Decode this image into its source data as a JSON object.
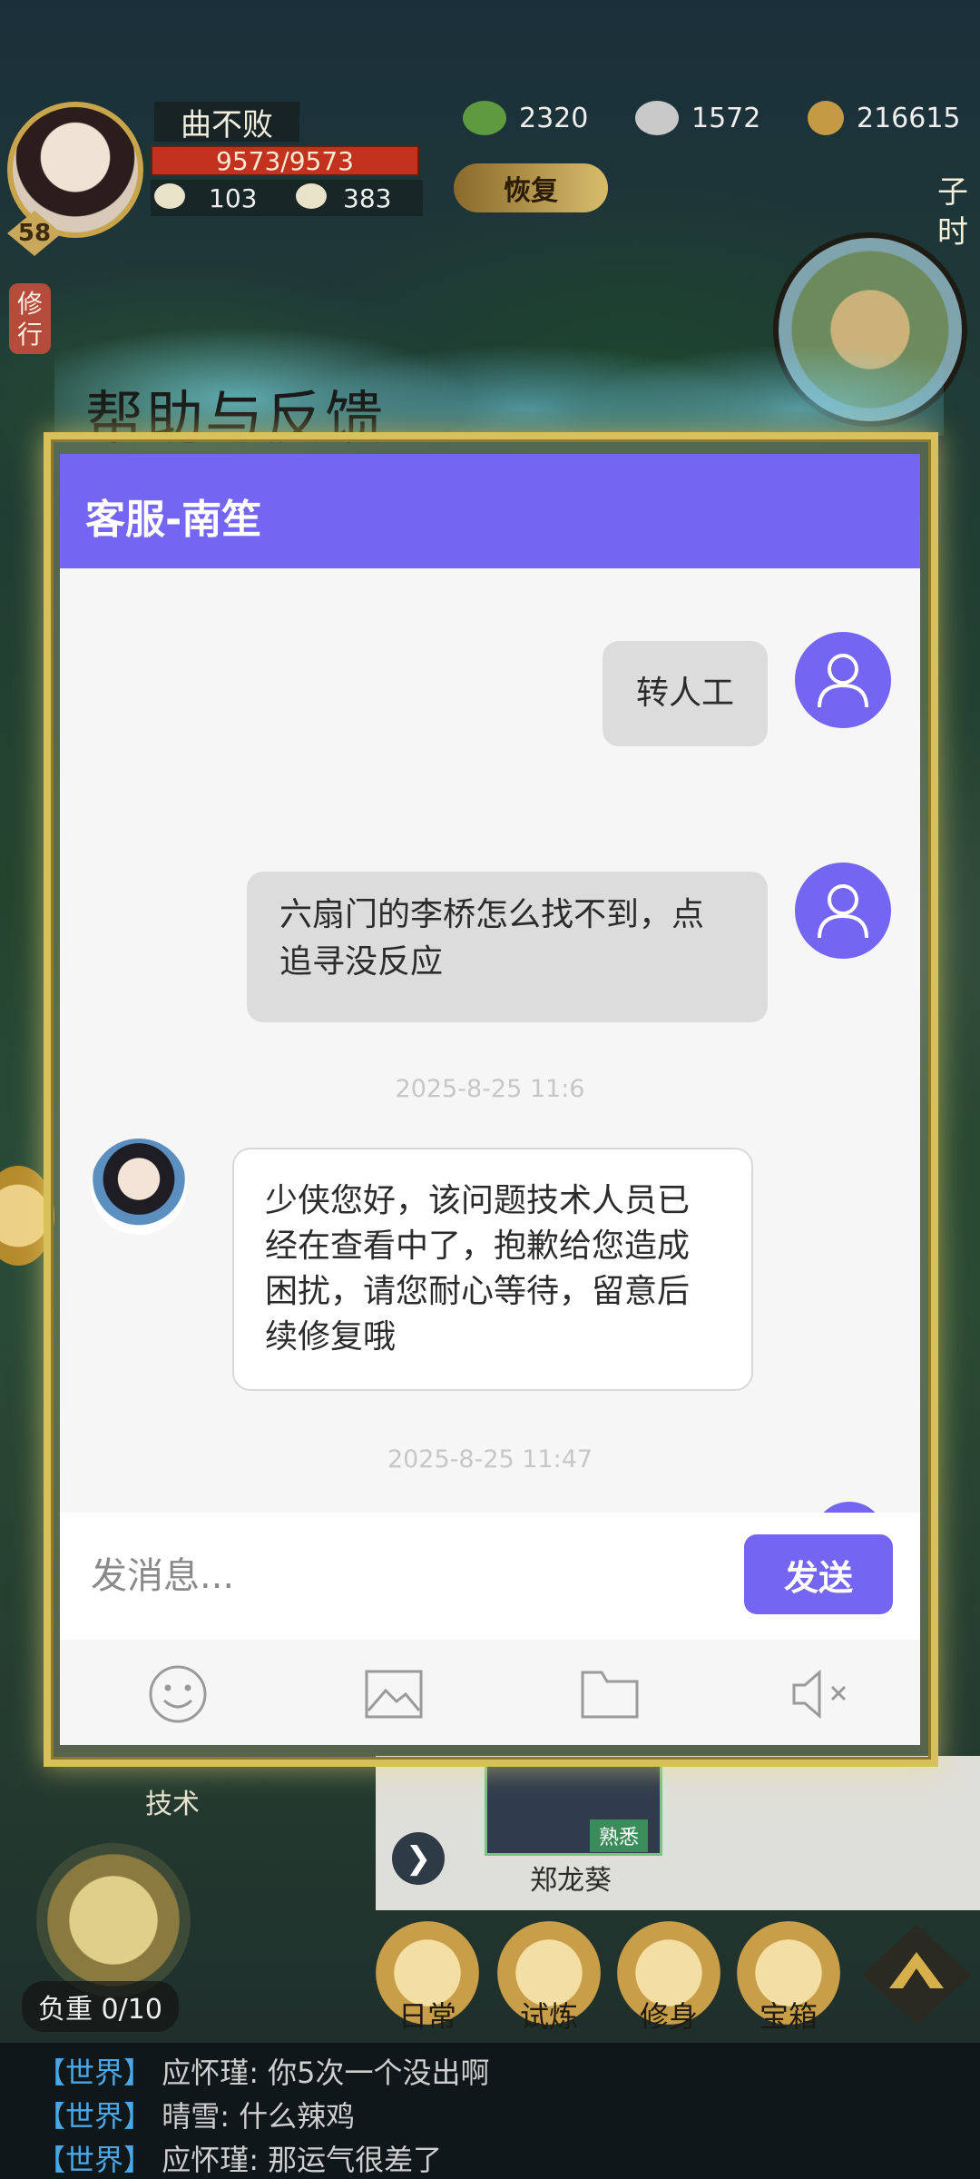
{
  "game_hud": {
    "player_name": "曲不败",
    "hp": "9573/9573",
    "level": "58",
    "stat_1": "103",
    "stat_2": "383",
    "currency_1": "2320",
    "currency_2": "1572",
    "currency_3": "216615",
    "recover_label": "恢复",
    "time_label": "子时",
    "practice_label": "修行",
    "help_title": "帮助与反馈"
  },
  "dialog": {
    "header_title": "客服-南笙",
    "messages": [
      {
        "sender": "user",
        "text": "转人工"
      },
      {
        "sender": "user",
        "text": "六扇门的李桥怎么找不到，点追寻没反应"
      },
      {
        "sender": "timestamp",
        "text": "2025-8-25 11:6"
      },
      {
        "sender": "agent",
        "text": "少侠您好，该问题技术人员已经在查看中了，抱歉给您造成困扰，请您耐心等待，留意后续修复哦"
      },
      {
        "sender": "timestamp",
        "text": "2025-8-25 11:47"
      }
    ],
    "input": {
      "placeholder": "发消息...",
      "value": ""
    },
    "send_label": "发送",
    "tools": [
      "emoji-icon",
      "image-icon",
      "folder-icon",
      "mute-icon"
    ],
    "accent_color": "#7466f2"
  },
  "bottom_hud": {
    "skill_label": "技术",
    "npc_name": "郑龙葵",
    "npc_tag": "熟悉",
    "load_label": "负重 0/10",
    "menu": [
      "日常",
      "试炼",
      "修身",
      "宝箱"
    ]
  },
  "chat_log": [
    {
      "channel": "【世界】",
      "text": "应怀瑾: 你5次一个没出啊"
    },
    {
      "channel": "【世界】",
      "text": "晴雪: 什么辣鸡"
    },
    {
      "channel": "【世界】",
      "text": "应怀瑾: 那运气很差了"
    }
  ]
}
